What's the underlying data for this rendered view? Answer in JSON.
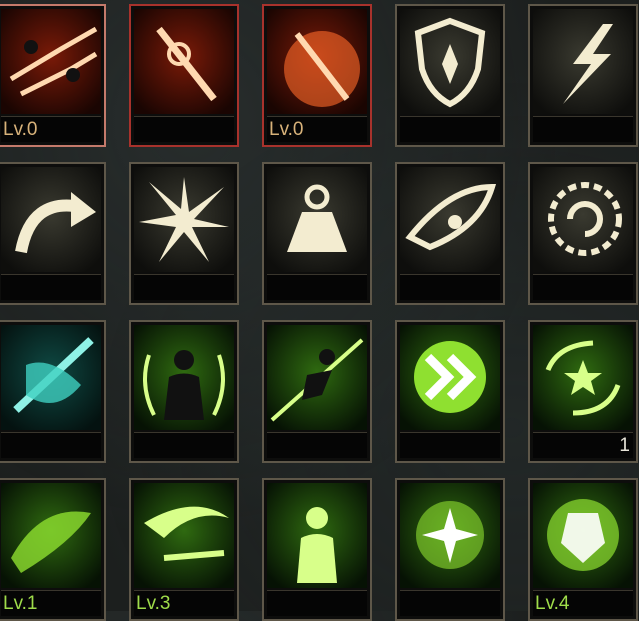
{
  "skills": [
    {
      "name": "twin-strike",
      "theme": "red",
      "bar_text": "Lv.0"
    },
    {
      "name": "flame-blade",
      "theme": "red",
      "bar_text": ""
    },
    {
      "name": "sun-sword",
      "theme": "red",
      "bar_text": "Lv.0"
    },
    {
      "name": "shield",
      "theme": "gold",
      "bar_text": ""
    },
    {
      "name": "lightning",
      "theme": "gold",
      "bar_text": ""
    },
    {
      "name": "curved-arrow",
      "theme": "gold",
      "bar_text": ""
    },
    {
      "name": "starburst",
      "theme": "gold",
      "bar_text": ""
    },
    {
      "name": "weight",
      "theme": "gold",
      "bar_text": ""
    },
    {
      "name": "eye",
      "theme": "gold",
      "bar_text": ""
    },
    {
      "name": "spiral-gear",
      "theme": "gold",
      "bar_text": ""
    },
    {
      "name": "crossed-feather",
      "theme": "cyan",
      "bar_text": ""
    },
    {
      "name": "aura-figure",
      "theme": "green",
      "bar_text": ""
    },
    {
      "name": "dash-figure",
      "theme": "green",
      "bar_text": ""
    },
    {
      "name": "double-chevron",
      "theme": "green",
      "bar_text": ""
    },
    {
      "name": "rune-star",
      "theme": "green",
      "bar_text": "1"
    },
    {
      "name": "rune-swirl",
      "theme": "green",
      "bar_text": "Lv.1"
    },
    {
      "name": "swirl-blade",
      "theme": "green",
      "bar_text": "Lv.3"
    },
    {
      "name": "glow-figure",
      "theme": "green",
      "bar_text": ""
    },
    {
      "name": "burst-star",
      "theme": "green",
      "bar_text": ""
    },
    {
      "name": "armor-mask",
      "theme": "green",
      "bar_text": "Lv.4"
    }
  ]
}
